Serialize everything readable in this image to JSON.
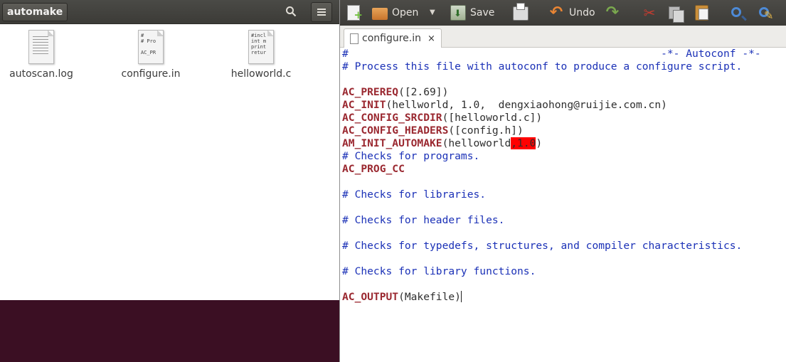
{
  "file_manager": {
    "path_label": "automake",
    "files": [
      {
        "name": "autoscan.log",
        "kind": "text-lines",
        "preview": ""
      },
      {
        "name": "configure.in",
        "kind": "text-preview",
        "preview": "#\n# Pro\n\nAC_PR"
      },
      {
        "name": "helloworld.c",
        "kind": "text-preview",
        "preview": "#incl\nint m\nprint\nretur"
      }
    ]
  },
  "editor": {
    "toolbar": {
      "open_label": "Open",
      "save_label": "Save",
      "undo_label": "Undo"
    },
    "tab": {
      "title": "configure.in",
      "close_glyph": "×"
    },
    "code_lines": [
      [
        {
          "t": "#                                                  -*- Autoconf -*-",
          "c": "comment"
        }
      ],
      [
        {
          "t": "# Process this file with autoconf to produce a configure script.",
          "c": "comment"
        }
      ],
      [],
      [
        {
          "t": "AC_PREREQ",
          "c": "macro"
        },
        {
          "t": "([2.69])",
          "c": "text"
        }
      ],
      [
        {
          "t": "AC_INIT",
          "c": "macro"
        },
        {
          "t": "(hellworld, 1.0,  dengxiaohong@ruijie.com.cn)",
          "c": "text"
        }
      ],
      [
        {
          "t": "AC_CONFIG_SRCDIR",
          "c": "macro"
        },
        {
          "t": "([helloworld.c])",
          "c": "text"
        }
      ],
      [
        {
          "t": "AC_CONFIG_HEADERS",
          "c": "macro"
        },
        {
          "t": "([config.h])",
          "c": "text"
        }
      ],
      [
        {
          "t": "AM_INIT_AUTOMAKE",
          "c": "macro"
        },
        {
          "t": "(helloworld",
          "c": "text"
        },
        {
          "t": ",1.0",
          "c": "hl"
        },
        {
          "t": ")",
          "c": "text"
        }
      ],
      [
        {
          "t": "# Checks for programs.",
          "c": "comment"
        }
      ],
      [
        {
          "t": "AC_PROG_CC",
          "c": "macro"
        }
      ],
      [],
      [
        {
          "t": "# Checks for libraries.",
          "c": "comment"
        }
      ],
      [],
      [
        {
          "t": "# Checks for header files.",
          "c": "comment"
        }
      ],
      [],
      [
        {
          "t": "# Checks for typedefs, structures, and compiler characteristics.",
          "c": "comment"
        }
      ],
      [],
      [
        {
          "t": "# Checks for library functions.",
          "c": "comment"
        }
      ],
      [],
      [
        {
          "t": "AC_OUTPUT",
          "c": "macro"
        },
        {
          "t": "(Makefile)",
          "c": "text"
        },
        {
          "t": "",
          "c": "caret"
        }
      ]
    ]
  },
  "colors": {
    "comment": "#1b31b7",
    "macro": "#9a2830",
    "highlight": "#ff0000",
    "desktop": "#3b0f23"
  }
}
